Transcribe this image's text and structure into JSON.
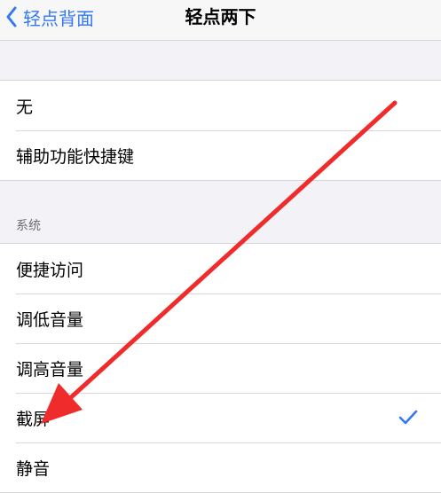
{
  "navbar": {
    "back_label": "轻点背面",
    "title": "轻点两下"
  },
  "group1": {
    "items": [
      {
        "label": "无"
      },
      {
        "label": "辅助功能快捷键"
      }
    ]
  },
  "system": {
    "header": "系统",
    "items": [
      {
        "label": "便捷访问"
      },
      {
        "label": "调低音量"
      },
      {
        "label": "调高音量"
      },
      {
        "label": "截屏",
        "selected": true
      },
      {
        "label": "静音"
      }
    ]
  },
  "colors": {
    "accent": "#3478f6",
    "annotation_arrow": "#f02b2b",
    "background": "#f2f2f7"
  },
  "icons": {
    "back": "chevron-left-icon",
    "selected": "checkmark-icon"
  }
}
